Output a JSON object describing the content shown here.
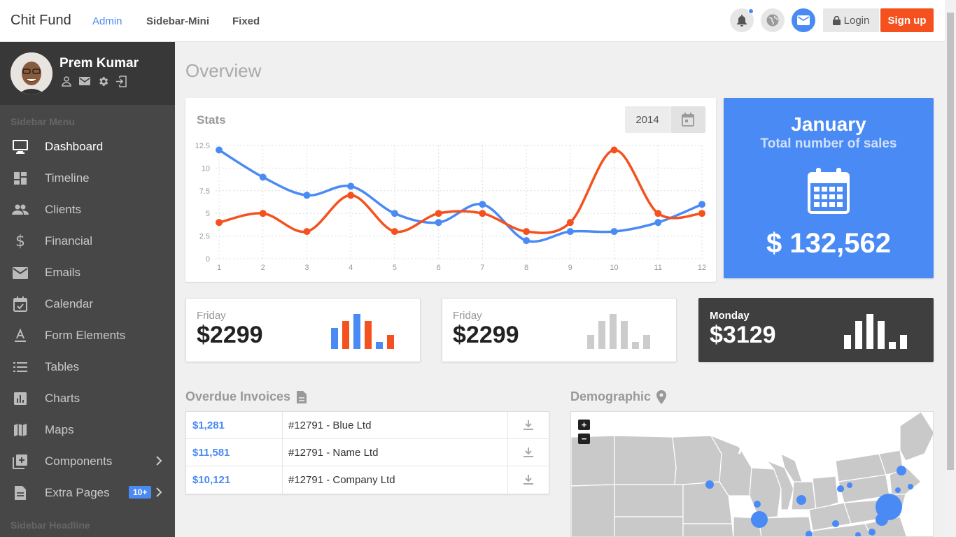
{
  "navbar": {
    "brand": "Chit Fund",
    "links": [
      {
        "label": "Admin",
        "active": true
      },
      {
        "label": "Sidebar-Mini",
        "active": false
      },
      {
        "label": "Fixed",
        "active": false
      }
    ],
    "icons": [
      "bell-icon",
      "globe-icon",
      "mail-icon"
    ],
    "login_label": "Login",
    "signup_label": "Sign up"
  },
  "profile": {
    "name": "Prem Kumar",
    "icons": [
      "user-icon",
      "mail-icon",
      "gear-icon",
      "logout-icon"
    ]
  },
  "sidebar": {
    "menu_heading": "Sidebar Menu",
    "items": [
      {
        "label": "Dashboard",
        "icon": "monitor-icon",
        "active": true
      },
      {
        "label": "Timeline",
        "icon": "dashboard-grid-icon"
      },
      {
        "label": "Clients",
        "icon": "people-icon"
      },
      {
        "label": "Financial",
        "icon": "dollar-icon"
      },
      {
        "label": "Emails",
        "icon": "mail-icon"
      },
      {
        "label": "Calendar",
        "icon": "calendar-check-icon"
      },
      {
        "label": "Form Elements",
        "icon": "text-format-icon"
      },
      {
        "label": "Tables",
        "icon": "list-icon"
      },
      {
        "label": "Charts",
        "icon": "bar-chart-icon"
      },
      {
        "label": "Maps",
        "icon": "map-icon"
      },
      {
        "label": "Components",
        "icon": "add-box-icon",
        "chevron": true
      },
      {
        "label": "Extra Pages",
        "icon": "document-icon",
        "badge": "10+",
        "chevron": true
      }
    ],
    "headline": "Sidebar Headline"
  },
  "main": {
    "title": "Overview",
    "stats": {
      "title": "Stats",
      "year": "2014"
    },
    "sales": {
      "month": "January",
      "subtitle": "Total number of sales",
      "amount": "$ 132,562"
    },
    "mini_cards": [
      {
        "day": "Friday",
        "amount": "$2299",
        "bars": [
          3,
          4,
          5,
          4,
          1,
          2
        ],
        "style": "color"
      },
      {
        "day": "Friday",
        "amount": "$2299",
        "bars": [
          2,
          4,
          5,
          4,
          1,
          2
        ],
        "style": "grey"
      },
      {
        "day": "Monday",
        "amount": "$3129",
        "bars": [
          2,
          4,
          5,
          4,
          1,
          2
        ],
        "style": "dark"
      }
    ],
    "invoices": {
      "title": "Overdue Invoices",
      "rows": [
        {
          "amount": "$1,281",
          "name": "#12791 - Blue Ltd"
        },
        {
          "amount": "$11,581",
          "name": "#12791 - Name Ltd"
        },
        {
          "amount": "$10,121",
          "name": "#12791 - Company Ltd"
        }
      ]
    },
    "demographic": {
      "title": "Demographic",
      "zoom_in": "+",
      "zoom_out": "−"
    }
  },
  "colors": {
    "accent": "#4a8af4",
    "orange": "#f4511e",
    "sidebar": "#474747",
    "dark_card": "#3f3f3f"
  },
  "chart_data": {
    "type": "line",
    "x": [
      1,
      2,
      3,
      4,
      5,
      6,
      7,
      8,
      9,
      10,
      11,
      12
    ],
    "series": [
      {
        "values": [
          12,
          9,
          7,
          8,
          5,
          4,
          6,
          2,
          3,
          3,
          4,
          6
        ],
        "color": "#4a8af4"
      },
      {
        "values": [
          4,
          5,
          3,
          7,
          3,
          5,
          5,
          3,
          4,
          12,
          5,
          5
        ],
        "color": "#f4511e"
      }
    ],
    "yticks": [
      "0",
      "2.5",
      "5",
      "7.5",
      "10",
      "12.5"
    ],
    "ytick_values": [
      0,
      2.5,
      5,
      7.5,
      10,
      12.5
    ],
    "ylim": [
      0,
      12.5
    ],
    "grid": true,
    "smooth": true
  }
}
